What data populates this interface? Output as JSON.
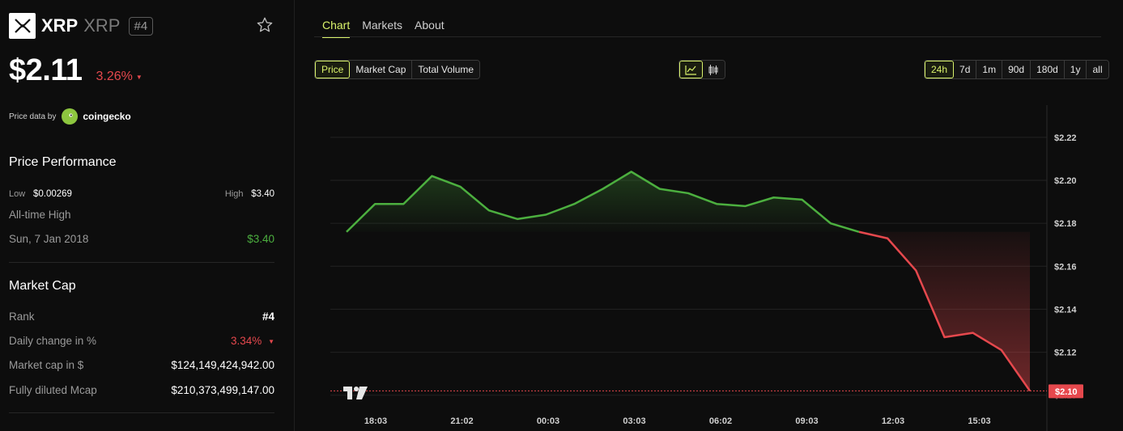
{
  "coin": {
    "name": "XRP",
    "symbol": "XRP",
    "rank_badge": "#4",
    "price": "$2.11",
    "change_24h": "3.26%",
    "price_data_label": "Price data by",
    "provider": "coingecko"
  },
  "performance": {
    "title": "Price Performance",
    "low_label": "Low",
    "low_value": "$0.00269",
    "high_label": "High",
    "high_value": "$3.40",
    "ath_label": "All-time High",
    "ath_date": "Sun, 7 Jan 2018",
    "ath_value": "$3.40"
  },
  "market_cap": {
    "title": "Market Cap",
    "rows": [
      {
        "label": "Rank",
        "value": "#4"
      },
      {
        "label": "Daily change in %",
        "value": "3.34%"
      },
      {
        "label": "Market cap in $",
        "value": "$124,149,424,942.00"
      },
      {
        "label": "Fully diluted Mcap",
        "value": "$210,373,499,147.00"
      }
    ]
  },
  "tabs": [
    {
      "label": "Chart",
      "active": true
    },
    {
      "label": "Markets",
      "active": false
    },
    {
      "label": "About",
      "active": false
    }
  ],
  "metric_buttons": [
    "Price",
    "Market Cap",
    "Total Volume"
  ],
  "chart_style_icons": [
    "line-chart-icon",
    "candlestick-icon"
  ],
  "range_buttons": [
    "24h",
    "7d",
    "1m",
    "90d",
    "180d",
    "1y",
    "all"
  ],
  "colors": {
    "accent": "#d9f26b",
    "up": "#4caf3f",
    "down": "#e5484d"
  },
  "chart_data": {
    "type": "line",
    "x_ticks": [
      "18:03",
      "21:02",
      "00:03",
      "03:03",
      "06:02",
      "09:03",
      "12:03",
      "15:03"
    ],
    "y_ticks": [
      "$2.22",
      "$2.20",
      "$2.18",
      "$2.16",
      "$2.14",
      "$2.12",
      "$2.10"
    ],
    "ylim": [
      2.095,
      2.235
    ],
    "baseline": 2.176,
    "current_price_label": "$2.10",
    "values": [
      2.176,
      2.189,
      2.189,
      2.202,
      2.197,
      2.186,
      2.182,
      2.184,
      2.189,
      2.196,
      2.204,
      2.196,
      2.194,
      2.189,
      2.188,
      2.192,
      2.191,
      2.18,
      2.176,
      2.173,
      2.158,
      2.127,
      2.129,
      2.121,
      2.102
    ]
  }
}
